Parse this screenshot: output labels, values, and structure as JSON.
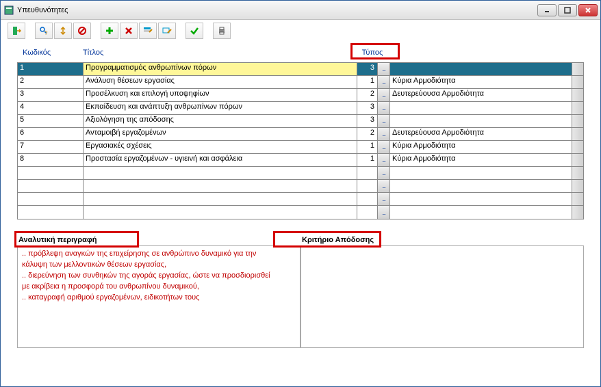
{
  "window": {
    "title": "Υπευθυνότητες"
  },
  "grid": {
    "headers": {
      "code": "Κωδικός",
      "title": "Τίτλος",
      "type": "Τύπος"
    },
    "rows": [
      {
        "code": "1",
        "title": "Προγραμματισμός ανθρωπίνων πόρων",
        "type": "3",
        "resp": ""
      },
      {
        "code": "2",
        "title": "Ανάλυση θέσεων εργασίας",
        "type": "1",
        "resp": "Κύρια Αρμοδιότητα"
      },
      {
        "code": "3",
        "title": "Προσέλκυση και επιλογή υποψηφίων",
        "type": "2",
        "resp": "Δευτερεύουσα Αρμοδιότητα"
      },
      {
        "code": "4",
        "title": "Εκπαίδευση και ανάπτυξη ανθρωπίνων πόρων",
        "type": "3",
        "resp": ""
      },
      {
        "code": "5",
        "title": "Αξιολόγηση της απόδοσης",
        "type": "3",
        "resp": ""
      },
      {
        "code": "6",
        "title": "Ανταμοιβή εργαζομένων",
        "type": "2",
        "resp": "Δευτερεύουσα Αρμοδιότητα"
      },
      {
        "code": "7",
        "title": "Εργασιακές σχέσεις",
        "type": "1",
        "resp": "Κύρια Αρμοδιότητα"
      },
      {
        "code": "8",
        "title": "Προστασία εργαζομένων - υγιεινή και ασφάλεια",
        "type": "1",
        "resp": "Κύρια Αρμοδιότητα"
      }
    ],
    "empty_rows": 4
  },
  "lower": {
    "desc_label": "Αναλυτική περιγραφή",
    "crit_label": "Κριτήριο Απόδοσης",
    "desc_lines": [
      ".. πρόβλεψη αναγκών της επιχείρησης σε ανθρώπινο δυναμικό για την",
      "κάλυψη των μελλοντικών θέσεων εργασίας,",
      ".. διερεύνηση των συνθηκών της αγοράς εργασίας, ώστε να προσδιορισθεί",
      "με ακρίβεια η προσφορά του ανθρωπίνου δυναμικού,",
      ".. καταγραφή αριθμού εργαζομένων, ειδικοτήτων τους"
    ]
  }
}
